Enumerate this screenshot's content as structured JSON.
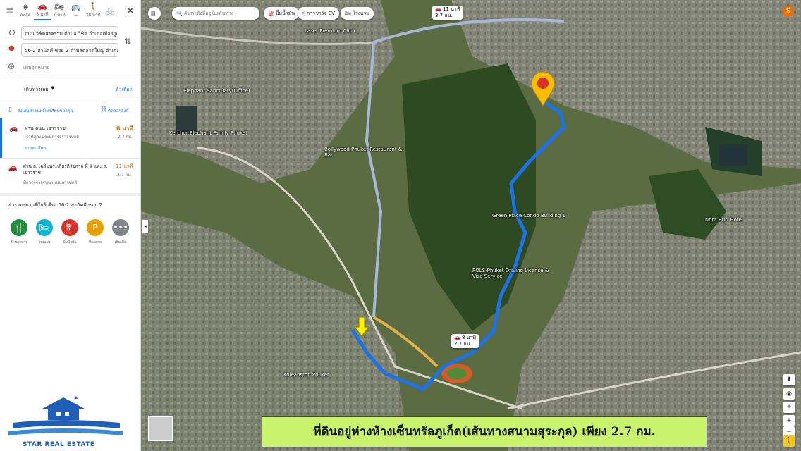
{
  "modes": [
    {
      "name": "best-mode",
      "label": "◈",
      "sub": "ดีที่สุด"
    },
    {
      "name": "car-mode",
      "label": "🚗",
      "sub": "8 นาที",
      "active": true
    },
    {
      "name": "motorbike-mode",
      "label": "🏍",
      "sub": "7 นาที"
    },
    {
      "name": "transit-mode",
      "label": "🚌",
      "sub": "—"
    },
    {
      "name": "walk-mode",
      "label": "🚶",
      "sub": "38 นาที"
    },
    {
      "name": "bicycle-mode",
      "label": "🚲",
      "sub": ""
    }
  ],
  "directions": {
    "origin": "ถนน วิชิตสงคราม ตำบล วิชิต อำเภอเมืองภูเก็ต",
    "destination": "56-2 สามัคคี ซอย 2 ตำบลตลาดใหญ่ อำเภอ",
    "add_destination": "เพิ่มจุดหมาย"
  },
  "options": {
    "depart_label": "เดินทางเลย",
    "options_link": "ตัวเลือก"
  },
  "send_to_phone": "ส่งเส้นทางไปที่โทรศัพท์ของคุณ",
  "copy_link": "คัดลอกลิงก์",
  "routes": [
    {
      "via": "ผ่าน ถนน เยาวราช",
      "desc": "เร็วที่สุดแม้จะมีการจราจรปกติ",
      "time": "8 นาที",
      "dist": "2.7 กม.",
      "details": "รายละเอียด"
    },
    {
      "via": "ผ่าน ถ. เฉลิมพระเกียรติรัชกาล ที่ 9 และ ถ. เยาวราช",
      "desc": "มีการจราจรหนาแน่นกว่าปกติ",
      "time": "11 นาที",
      "dist": "3.7 กม."
    }
  ],
  "nearby": {
    "title": "สำรวจสถานที่ใกล้เคียง 56-2 สามัคคี ซอย 2",
    "items": [
      {
        "name": "restaurants",
        "icon": "🍴",
        "label": "ร้านอาหาร",
        "color": "#1e8e3e"
      },
      {
        "name": "hotels",
        "icon": "🛏",
        "label": "โรงแรม",
        "color": "#12b5cb"
      },
      {
        "name": "gas-stations",
        "icon": "⛽",
        "label": "ปั๊มน้ำมัน",
        "color": "#d93025"
      },
      {
        "name": "parking",
        "icon": "P",
        "label": "ที่จอดรถ",
        "color": "#e8a000"
      },
      {
        "name": "more",
        "icon": "•••",
        "label": "เพิ่มเติม",
        "color": "#80868b"
      }
    ]
  },
  "map": {
    "search_placeholder": "ค้นหาสิ่งที่อยู่ในเส้นทาง",
    "chips": [
      "ปั๊มน้ำมัน",
      "การชาร์จ EV",
      "โรงแรม"
    ],
    "route_time_top": "11 นาที",
    "route_dist_top": "3.7 กม.",
    "route_time_badge": "8 นาที",
    "route_dist_badge": "2.7 กม.",
    "labels": [
      "Kerchor Elephant Family Phuket",
      "Elephant Sanctuary(Office)",
      "Bollywood Phuket Restaurant & Bar",
      "Green Place Condo Building 1",
      "POLS-Phuket Driving License & Visa Service",
      "Nora Buri Hotel",
      "Laser Premium Clinic",
      "Koleanston Phuket"
    ],
    "user_initial": "S"
  },
  "caption": "ที่ดินอยู่ห่างห้างเซ็นทรัลภูเก็ต(เส้นทางสนามสุระกุล)  เพียง 2.7 กม.",
  "logo_text": "STAR REAL ESTATE"
}
